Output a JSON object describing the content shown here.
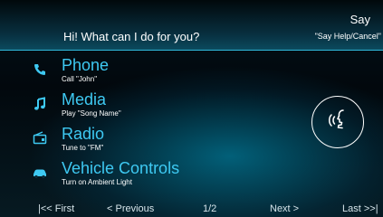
{
  "header": {
    "prompt": "Hi! What can I do for you?",
    "say_title": "Say",
    "say_hint": "\"Say Help/Cancel\""
  },
  "menu": {
    "items": [
      {
        "title": "Phone",
        "subtitle": "Call \"John\"",
        "icon": "phone-icon"
      },
      {
        "title": "Media",
        "subtitle": "Play \"Song Name\"",
        "icon": "music-note-icon"
      },
      {
        "title": "Radio",
        "subtitle": "Tune to \"FM\"",
        "icon": "radio-icon"
      },
      {
        "title": "Vehicle Controls",
        "subtitle": "Turn on Ambient Light",
        "icon": "car-icon"
      }
    ]
  },
  "voice": {
    "icon": "voice-speaking-icon"
  },
  "navigation": {
    "first": "|<< First",
    "previous": "< Previous",
    "page": "1/2",
    "next": "Next >",
    "last": "Last >>|"
  },
  "colors": {
    "accent": "#3ec9f2",
    "header_line": "#2fb6d8",
    "background": "#02080c"
  }
}
